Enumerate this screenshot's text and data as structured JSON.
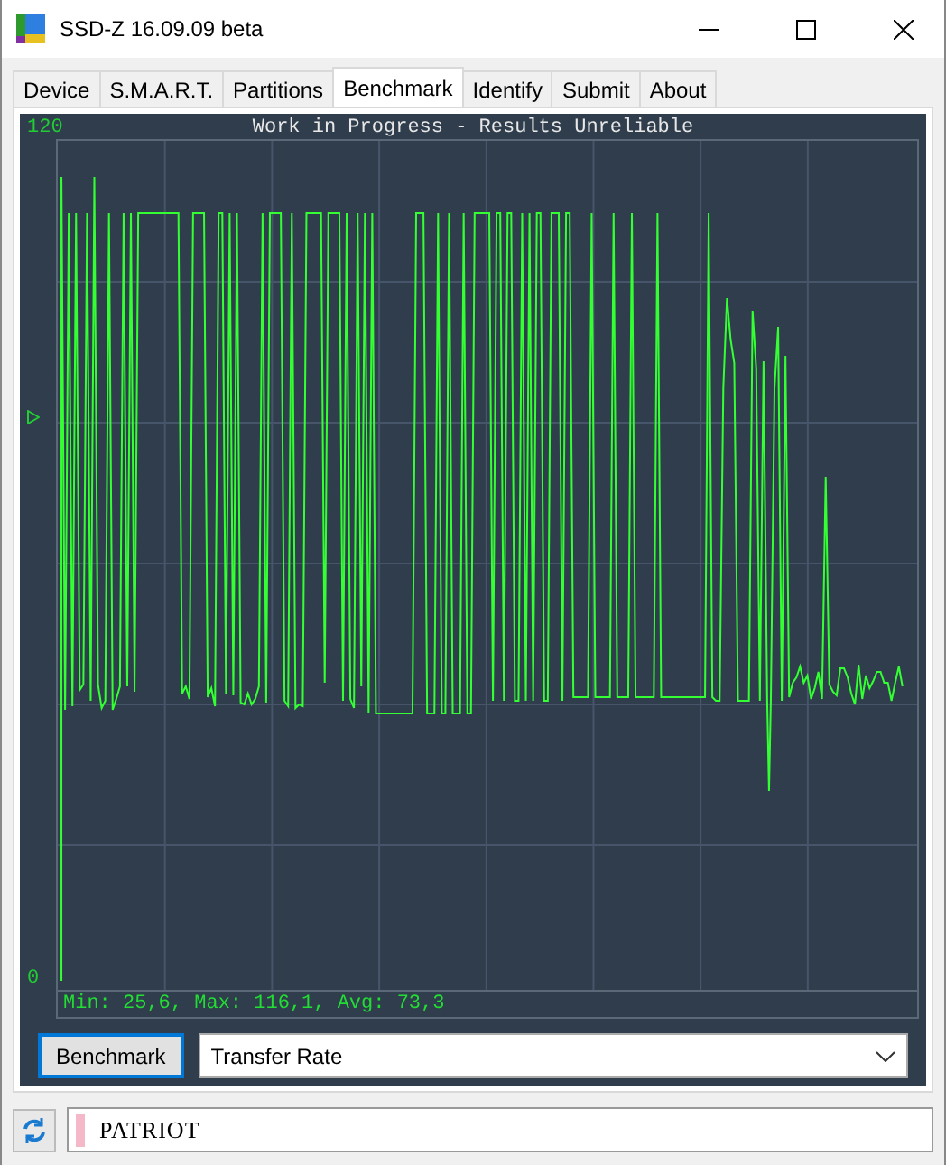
{
  "window": {
    "title": "SSD-Z 16.09.09 beta"
  },
  "tabs": [
    {
      "label": "Device",
      "selected": false
    },
    {
      "label": "S.M.A.R.T.",
      "selected": false
    },
    {
      "label": "Partitions",
      "selected": false
    },
    {
      "label": "Benchmark",
      "selected": true
    },
    {
      "label": "Identify",
      "selected": false
    },
    {
      "label": "Submit",
      "selected": false
    },
    {
      "label": "About",
      "selected": false
    }
  ],
  "graph": {
    "title": "Work in Progress - Results Unreliable",
    "y_max_label": "120",
    "y_min_label": "0",
    "stats": "Min: 25,6, Max: 116,1, Avg: 73,3"
  },
  "controls": {
    "button": "Benchmark",
    "mode": "Transfer Rate"
  },
  "status_bar": {
    "drive": "PATRIOT"
  }
}
